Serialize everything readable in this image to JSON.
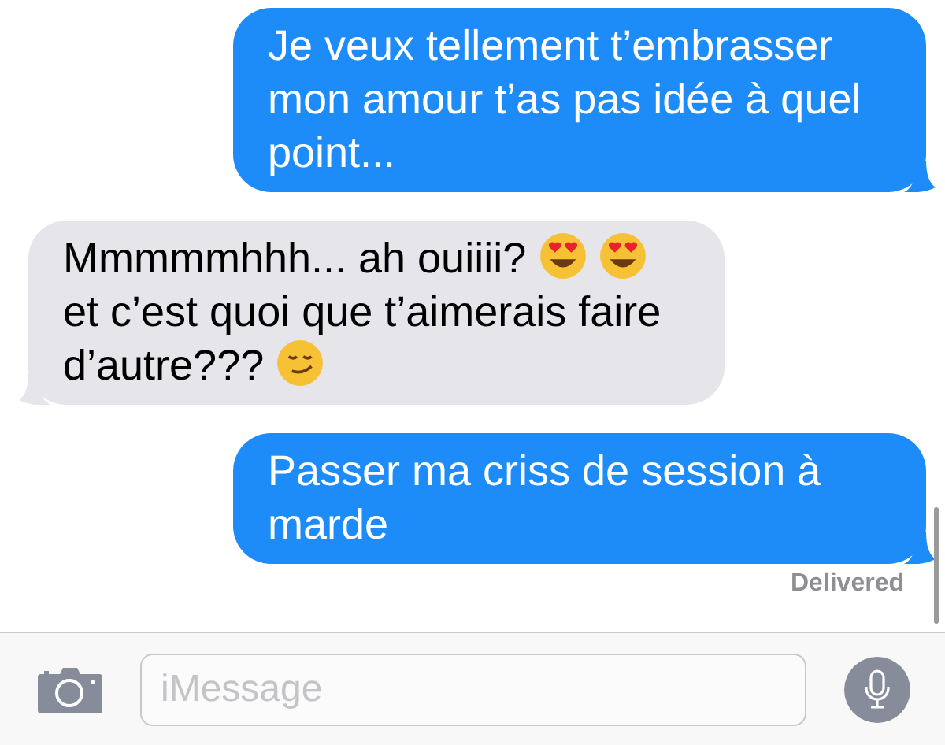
{
  "messages": [
    {
      "kind": "sent",
      "segments": [
        {
          "kind": "text",
          "text": "Je veux tellement t’embrasser mon amour t’as pas idée à quel point..."
        }
      ]
    },
    {
      "kind": "received",
      "segments": [
        {
          "kind": "text",
          "text": "Mmmmmhhh... ah ouiiii?"
        },
        {
          "kind": "heart-eyes"
        },
        {
          "kind": "heart-eyes"
        },
        {
          "kind": "text",
          "text": "et c’est quoi que t’aimerais faire"
        },
        {
          "kind": "text",
          "text": "d’autre???"
        },
        {
          "kind": "smirk"
        }
      ]
    },
    {
      "kind": "sent",
      "segments": [
        {
          "kind": "text",
          "text": "Passer ma criss de session à marde"
        }
      ]
    }
  ],
  "status": "Delivered",
  "composer": {
    "placeholder": "iMessage"
  }
}
